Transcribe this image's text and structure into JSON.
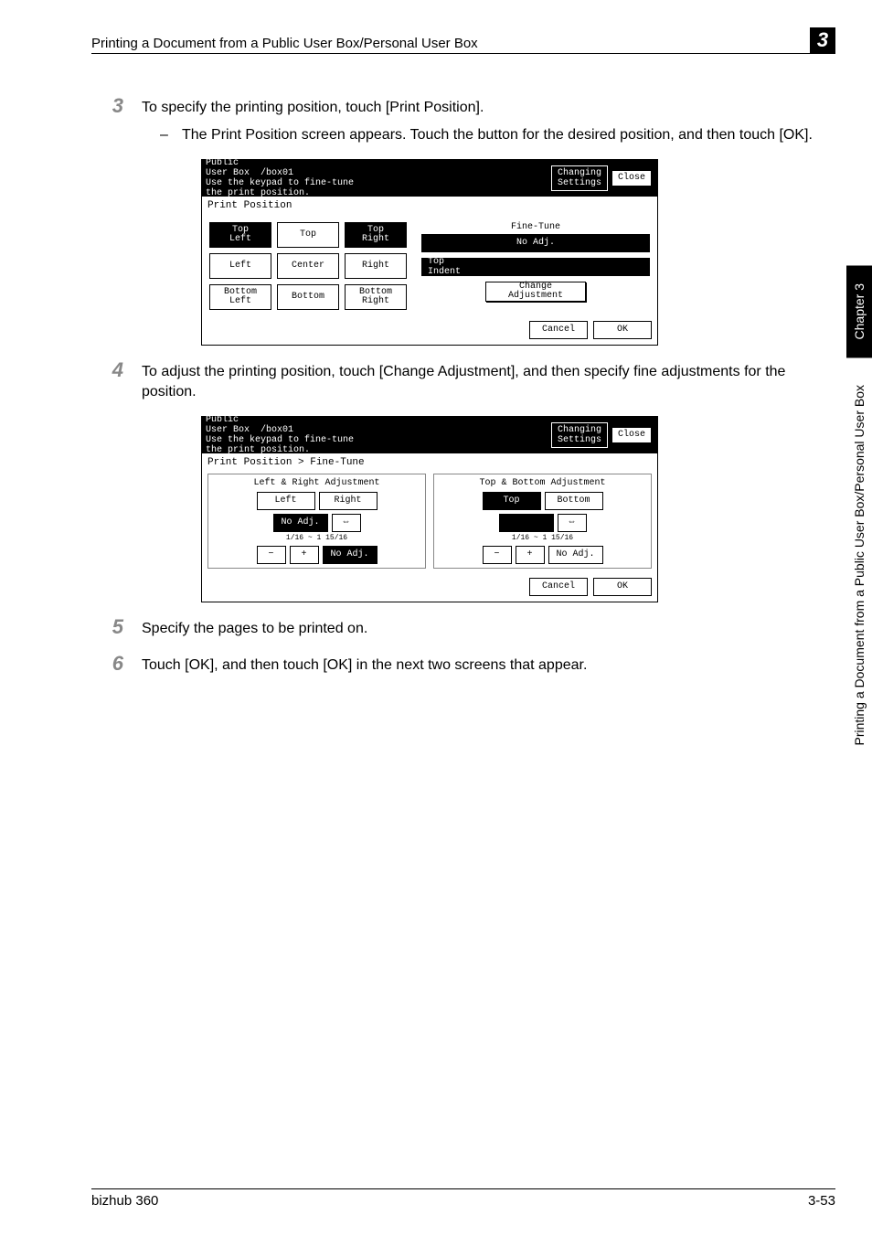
{
  "header": {
    "title": "Printing a Document from a Public User Box/Personal User Box",
    "chapter_number": "3"
  },
  "sidebar": {
    "chapter_label": "Chapter 3",
    "side_title": "Printing a Document from a Public User Box/Personal User Box"
  },
  "steps": {
    "s3": {
      "num": "3",
      "text": "To specify the printing position, touch [Print Position].",
      "bullet": "The Print Position screen appears. Touch the button for the desired position, and then touch [OK]."
    },
    "s4": {
      "num": "4",
      "text": "To adjust the printing position, touch [Change Adjustment], and then specify fine adjustments for the position."
    },
    "s5": {
      "num": "5",
      "text": "Specify the pages to be printed on."
    },
    "s6": {
      "num": "6",
      "text": "Touch [OK], and then touch [OK] in the next two screens that appear."
    }
  },
  "screen1": {
    "topbar_left": "Public\nUser Box  /box01\nUse the keypad to fine-tune\nthe print position.",
    "changing_settings": "Changing\nSettings",
    "close": "Close",
    "title": "Print Position",
    "grid": {
      "tl": "Top\nLeft",
      "tc": "Top",
      "tr": "Top\nRight",
      "ml": "Left",
      "mc": "Center",
      "mr": "Right",
      "bl": "Bottom\nLeft",
      "bc": "Bottom",
      "br": "Bottom\nRight"
    },
    "fine_tune": "Fine-Tune",
    "no_adj": "No Adj.",
    "top_indent": "Top\nIndent",
    "change_adj": "Change\nAdjustment",
    "cancel": "Cancel",
    "ok": "OK"
  },
  "screen2": {
    "topbar_left": "Public\nUser Box  /box01\nUse the keypad to fine-tune\nthe print position.",
    "changing_settings": "Changing\nSettings",
    "close": "Close",
    "title": "Print Position > Fine-Tune",
    "left_panel": {
      "title": "Left & Right Adjustment",
      "left": "Left",
      "right": "Right",
      "no_adj": "No Adj.",
      "range": "1/16  ~  1 15/16",
      "minus": "−",
      "plus": "+",
      "val": "No Adj."
    },
    "right_panel": {
      "title": "Top & Bottom Adjustment",
      "top": "Top",
      "bottom": "Bottom",
      "range": "1/16  ~  1 15/16",
      "arrow": "⇔",
      "minus": "−",
      "plus": "+",
      "val": "No Adj."
    },
    "cancel": "Cancel",
    "ok": "OK"
  },
  "footer": {
    "left": "bizhub 360",
    "right": "3-53"
  },
  "glyphs": {
    "dash": "–",
    "dbl_arrow": "⇔"
  }
}
